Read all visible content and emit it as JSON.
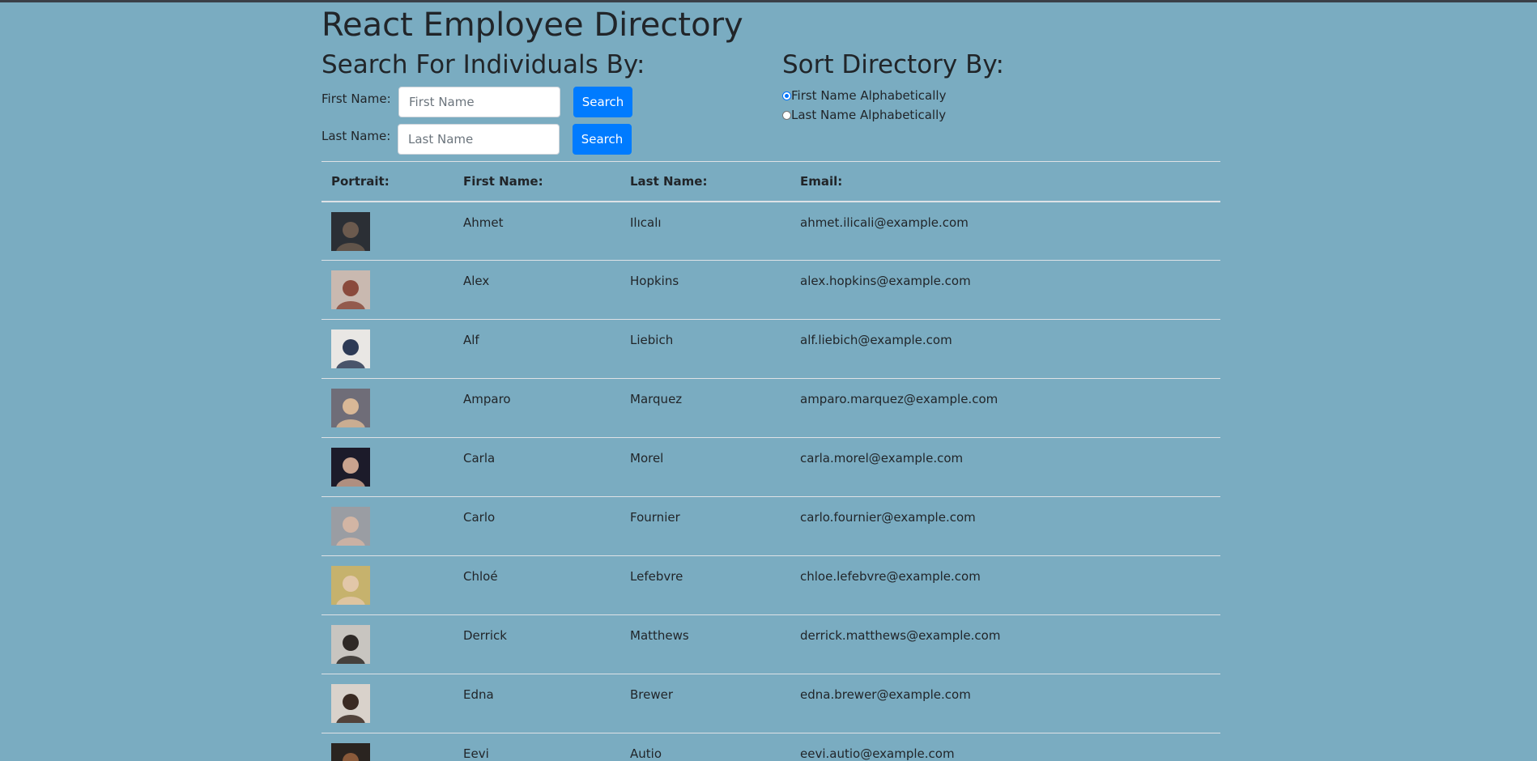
{
  "page_title": "React Employee Directory",
  "search": {
    "heading": "Search For Individuals By:",
    "first_label": "First Name:",
    "first_placeholder": "First Name",
    "first_button": "Search",
    "last_label": "Last Name:",
    "last_placeholder": "Last Name",
    "last_button": "Search"
  },
  "sort": {
    "heading": "Sort Directory By:",
    "options": [
      {
        "label": "First Name Alphabetically",
        "checked": true
      },
      {
        "label": "Last Name Alphabetically",
        "checked": false
      }
    ]
  },
  "table": {
    "headers": [
      "Portrait:",
      "First Name:",
      "Last Name:",
      "Email:"
    ],
    "rows": [
      {
        "first": "Ahmet",
        "last": "Ilıcalı",
        "email": "ahmet.ilicali@example.com",
        "colors": [
          "#2b2f35",
          "#6b5a4e"
        ]
      },
      {
        "first": "Alex",
        "last": "Hopkins",
        "email": "alex.hopkins@example.com",
        "colors": [
          "#c9b9b0",
          "#8a4a3c"
        ]
      },
      {
        "first": "Alf",
        "last": "Liebich",
        "email": "alf.liebich@example.com",
        "colors": [
          "#e9e7e4",
          "#2d3a55"
        ]
      },
      {
        "first": "Amparo",
        "last": "Marquez",
        "email": "amparo.marquez@example.com",
        "colors": [
          "#6f6d78",
          "#d9b897"
        ]
      },
      {
        "first": "Carla",
        "last": "Morel",
        "email": "carla.morel@example.com",
        "colors": [
          "#1c1b2a",
          "#c9a38f"
        ]
      },
      {
        "first": "Carlo",
        "last": "Fournier",
        "email": "carlo.fournier@example.com",
        "colors": [
          "#9a9da3",
          "#d2b5a4"
        ]
      },
      {
        "first": "Chloé",
        "last": "Lefebvre",
        "email": "chloe.lefebvre@example.com",
        "colors": [
          "#c6b26d",
          "#e2c7a9"
        ]
      },
      {
        "first": "Derrick",
        "last": "Matthews",
        "email": "derrick.matthews@example.com",
        "colors": [
          "#c8c5c0",
          "#2e2926"
        ]
      },
      {
        "first": "Edna",
        "last": "Brewer",
        "email": "edna.brewer@example.com",
        "colors": [
          "#d9d2cb",
          "#3a2a22"
        ]
      },
      {
        "first": "Eevi",
        "last": "Autio",
        "email": "eevi.autio@example.com",
        "colors": [
          "#2a2420",
          "#8a5a3a"
        ]
      }
    ]
  }
}
